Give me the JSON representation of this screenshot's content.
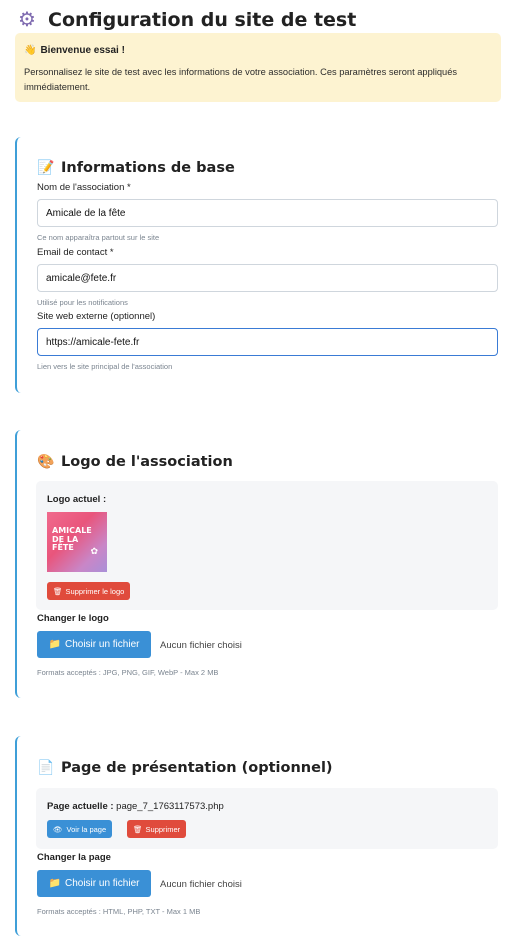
{
  "header": {
    "title": "Configuration du site de test",
    "icon": "gear-icon"
  },
  "welcome": {
    "icon": "waving-hand-icon",
    "title": "Bienvenue essai !",
    "text": "Personnalisez le site de test avec les informations de votre association. Ces paramètres seront appliqués immédiatement."
  },
  "basic": {
    "icon": "memo-icon",
    "title": "Informations de base",
    "name_label": "Nom de l'association *",
    "name_value": "Amicale de la fête",
    "name_hint": "Ce nom apparaîtra partout sur le site",
    "email_label": "Email de contact *",
    "email_value": "amicale@fete.fr",
    "email_hint": "Utilisé pour les notifications",
    "web_label": "Site web externe (optionnel)",
    "web_value": "https://amicale-fete.fr",
    "web_hint": "Lien vers le site principal de l'association"
  },
  "logo": {
    "icon": "palette-icon",
    "title": "Logo de l'association",
    "current_label": "Logo actuel :",
    "logo_lines": [
      "AMICALE",
      "DE LA",
      "FÊTE"
    ],
    "delete_label": "Supprimer le logo",
    "change_label": "Changer le logo",
    "choose_label": "Choisir un fichier",
    "no_file": "Aucun fichier choisi",
    "formats": "Formats acceptés : JPG, PNG, GIF, WebP - Max 2 MB"
  },
  "presentation": {
    "icon": "page-icon",
    "title": "Page de présentation (optionnel)",
    "current_label": "Page actuelle :",
    "current_value": "page_7_1763117573.php",
    "view_label": "Voir la page",
    "delete_label": "Supprimer",
    "change_label": "Changer la page",
    "choose_label": "Choisir un fichier",
    "no_file": "Aucun fichier choisi",
    "formats": "Formats acceptés : HTML, PHP, TXT - Max 1 MB"
  },
  "colors": {
    "accent": "#3f9fd8",
    "danger": "#e04b3c",
    "primary": "#3a90d6",
    "notice": "#fdf3d1"
  }
}
